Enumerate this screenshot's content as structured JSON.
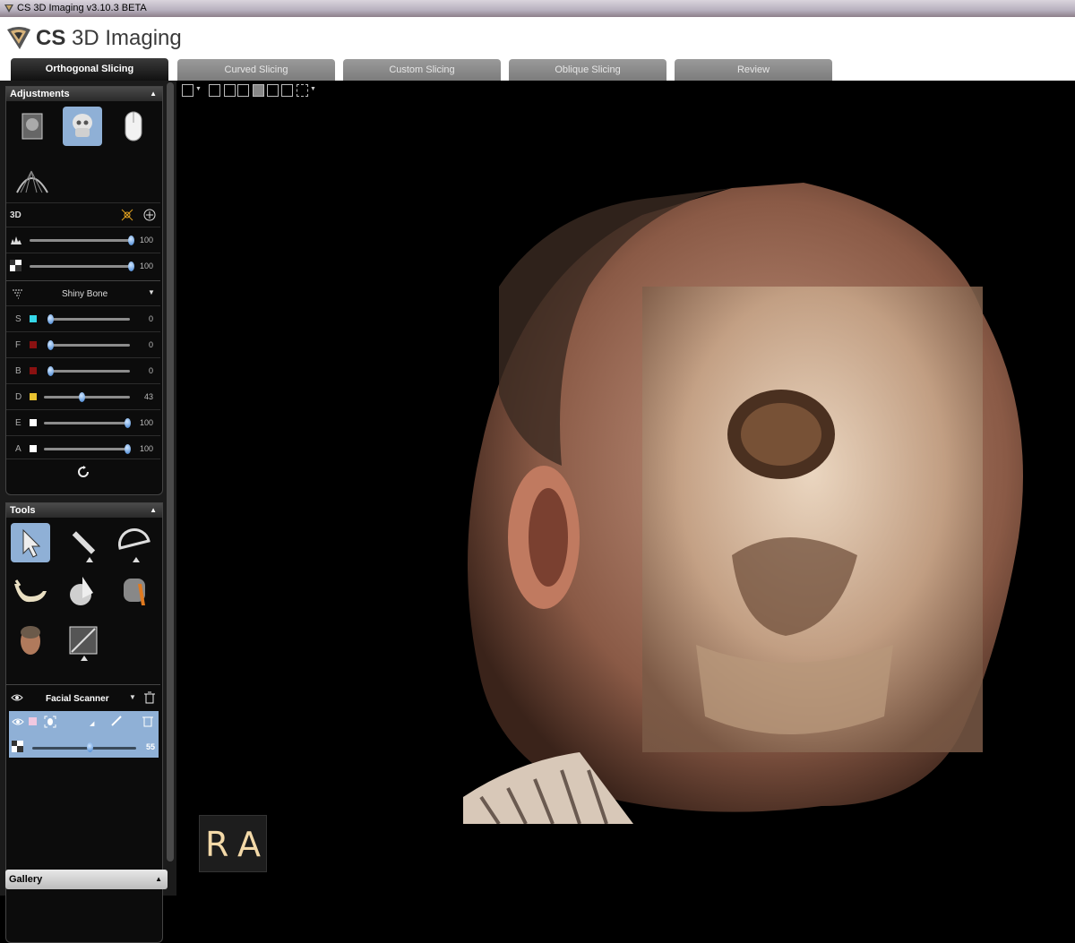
{
  "window": {
    "title": "CS 3D Imaging v3.10.3 BETA"
  },
  "brand": {
    "name_bold": "CS",
    "name_rest": " 3D Imaging"
  },
  "tabs": [
    {
      "label": "Orthogonal Slicing",
      "active": true
    },
    {
      "label": "Curved Slicing"
    },
    {
      "label": "Custom Slicing"
    },
    {
      "label": "Oblique Slicing"
    },
    {
      "label": "Review"
    }
  ],
  "adjustments": {
    "title": "Adjustments",
    "mode_label": "3D",
    "opacity_value": "100",
    "transparency_value": "100",
    "preset": "Shiny Bone",
    "channels": [
      {
        "letter": "S",
        "color": "#35d7e8",
        "value": "0",
        "level": 0
      },
      {
        "letter": "F",
        "color": "#8a1111",
        "value": "0",
        "level": 0
      },
      {
        "letter": "B",
        "color": "#8a1111",
        "value": "0",
        "level": 0
      },
      {
        "letter": "D",
        "color": "#e8c230",
        "value": "43",
        "level": 0.43
      },
      {
        "letter": "E",
        "color": "#ffffff",
        "value": "100",
        "level": 1
      },
      {
        "letter": "A",
        "color": "#ffffff",
        "value": "100",
        "level": 1
      }
    ]
  },
  "tools": {
    "title": "Tools",
    "layer_name": "Facial Scanner",
    "layer_opacity": "55"
  },
  "gallery": {
    "title": "Gallery"
  },
  "orientation": {
    "left": "R",
    "right": "A"
  }
}
